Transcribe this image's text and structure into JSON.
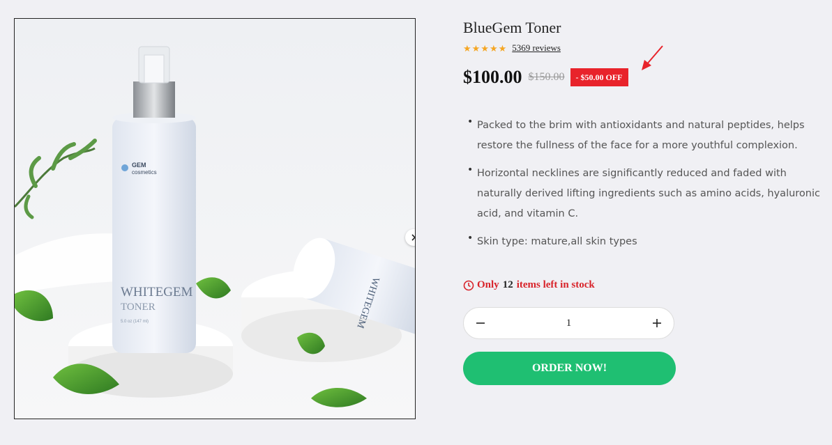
{
  "product": {
    "title": "BlueGem Toner",
    "rating_stars": 5,
    "reviews_label": "5369 reviews",
    "price": "$100.00",
    "compare_price": "$150.00",
    "discount_badge": "- $50.00 OFF",
    "features": [
      "Packed to the brim with antioxidants and natural peptides, helps restore the fullness of the face for a more youthful complexion.",
      "Horizontal necklines are significantly reduced and faded with naturally derived lifting ingredients such as amino acids, hyaluronic acid, and vitamin C.",
      "Skin type: mature,all skin types"
    ],
    "stock": {
      "prefix": "Only",
      "count": "12",
      "suffix": "items left in stock"
    },
    "quantity": "1",
    "order_button": "ORDER NOW!"
  },
  "image": {
    "bottle_brand": "GEM",
    "bottle_brand_sub": "cosmetics",
    "bottle_name": "WHITEGEM",
    "bottle_type": "TONER",
    "bottle_volume": "5.0 oz (147 ml)"
  },
  "colors": {
    "accent_red": "#e8232b",
    "order_green": "#1fbf72",
    "star": "#f5a623"
  },
  "icons": {
    "next": "chevron-right-icon",
    "stock": "clock-icon",
    "minus": "minus-icon",
    "plus": "plus-icon",
    "annotation": "red-arrow-icon"
  }
}
